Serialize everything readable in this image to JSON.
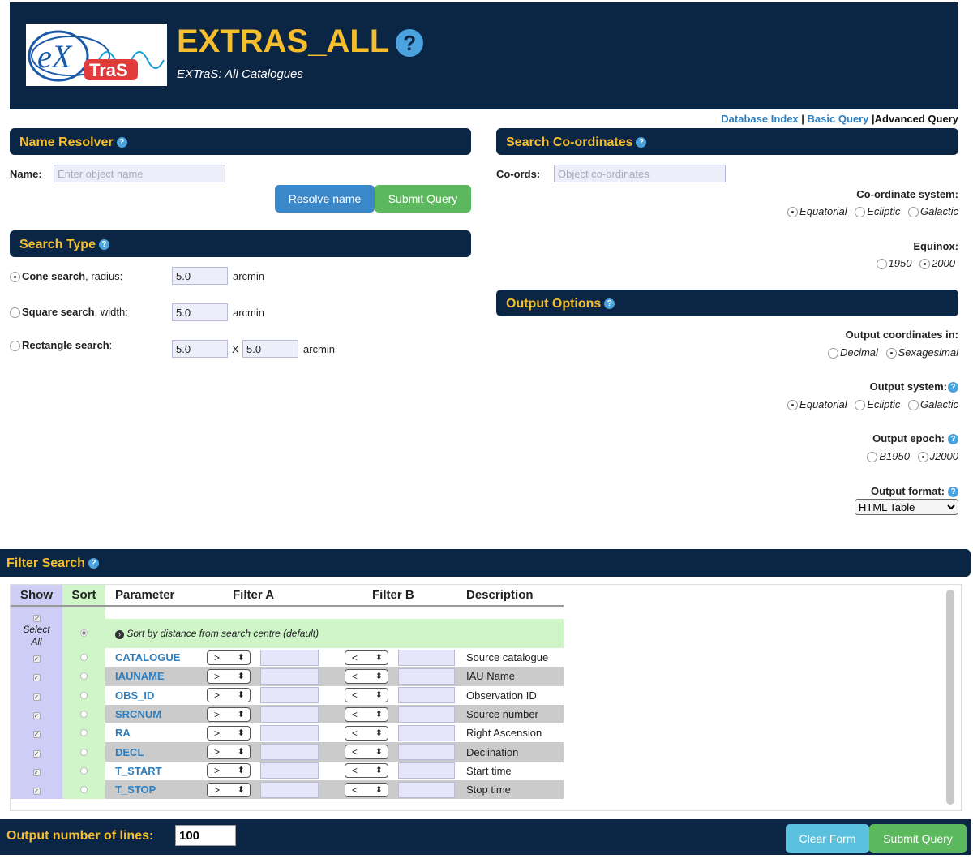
{
  "header": {
    "title": "EXTRAS_ALL",
    "subtitle": "EXTraS: All Catalogues",
    "logo_text_top": "eX",
    "logo_text_bottom": "TraS"
  },
  "topnav": {
    "database_index": "Database Index",
    "basic_query": "Basic Query",
    "advanced_query": "Advanced Query"
  },
  "name_resolver": {
    "title": "Name Resolver",
    "name_label": "Name:",
    "name_placeholder": "Enter object name",
    "resolve_button": "Resolve name",
    "submit_button": "Submit Query"
  },
  "search_type": {
    "title": "Search Type",
    "cone_bold": "Cone search",
    "cone_rest": ", radius:",
    "cone_value": "5.0",
    "square_bold": "Square search",
    "square_rest": ", width:",
    "square_value": "5.0",
    "rect_bold": "Rectangle search",
    "rect_rest": ":",
    "rect_value_a": "5.0",
    "rect_x": "X",
    "rect_value_b": "5.0",
    "unit": "arcmin"
  },
  "search_coords": {
    "title": "Search Co-ordinates",
    "coords_label": "Co-ords:",
    "coords_placeholder": "Object co-ordinates",
    "system_title": "Co-ordinate system:",
    "system_options": [
      "Equatorial",
      "Ecliptic",
      "Galactic"
    ],
    "equinox_title": "Equinox:",
    "equinox_options": [
      "1950",
      "2000"
    ]
  },
  "output_options": {
    "title": "Output Options",
    "coords_in_title": "Output coordinates in:",
    "coords_in_options": [
      "Decimal",
      "Sexagesimal"
    ],
    "system_title": "Output system:",
    "system_options": [
      "Equatorial",
      "Ecliptic",
      "Galactic"
    ],
    "epoch_title": "Output epoch:",
    "epoch_options": [
      "B1950",
      "J2000"
    ],
    "format_title": "Output format:",
    "format_value": "HTML Table"
  },
  "filter_search": {
    "title": "Filter Search",
    "headers": [
      "Show",
      "Sort",
      "Parameter",
      "Filter A",
      "Filter B",
      "Description"
    ],
    "select_all": "Select All",
    "sort_default": "Sort by distance from search centre (default)",
    "op_a": ">",
    "op_b": "<",
    "rows": [
      {
        "param": "CATALOGUE",
        "desc": "Source catalogue"
      },
      {
        "param": "IAUNAME",
        "desc": "IAU Name"
      },
      {
        "param": "OBS_ID",
        "desc": "Observation ID"
      },
      {
        "param": "SRCNUM",
        "desc": "Source number"
      },
      {
        "param": "RA",
        "desc": "Right Ascension"
      },
      {
        "param": "DECL",
        "desc": "Declination"
      },
      {
        "param": "T_START",
        "desc": "Start time"
      },
      {
        "param": "T_STOP",
        "desc": "Stop time"
      }
    ]
  },
  "bottom": {
    "lines_label": "Output number of lines:",
    "lines_value": "100",
    "clear_button": "Clear Form",
    "submit_button": "Submit Query"
  },
  "colors": {
    "navy": "#0b2545",
    "gold": "#f6be2c",
    "link_blue": "#2f7fbf",
    "button_blue": "#3a87c9",
    "button_green": "#5cb85c",
    "button_cyan": "#5bc0de"
  }
}
